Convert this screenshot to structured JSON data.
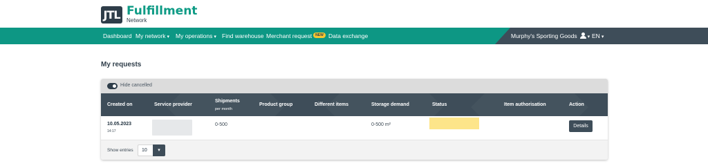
{
  "brand": {
    "logo_mark": "JTL",
    "name": "Fulfillment",
    "sub": "Network"
  },
  "nav": {
    "items": [
      {
        "label": "Dashboard"
      },
      {
        "label": "My network"
      },
      {
        "label": "My operations"
      },
      {
        "label": "Find warehouse"
      },
      {
        "label": "Merchant request",
        "badge": "NEW"
      },
      {
        "label": "Data exchange"
      }
    ],
    "account_name": "Murphy's Sporting Goods",
    "language": "EN",
    "chevron": "▾",
    "user_icon": "user-icon"
  },
  "page": {
    "title": "My requests"
  },
  "filter": {
    "toggle_label": "Hide cancelled",
    "toggle_on": true
  },
  "table": {
    "headers": {
      "created_on": "Created on",
      "service_provider": "Service provider",
      "shipments": "Shipments",
      "shipments_sub": "per month",
      "product_group": "Product group",
      "different_items": "Different items",
      "storage_demand": "Storage demand",
      "status": "Status",
      "item_authorisation": "Item authorisation",
      "action": "Action"
    },
    "rows": [
      {
        "date": "10.05.2023",
        "time": "14:17",
        "shipments": "0-500",
        "storage_demand": "0-500 m²",
        "action": "Details"
      }
    ]
  },
  "footer": {
    "show_entries_label": "Show entries",
    "entries_value": "10",
    "dropdown_icon": "chevron-down-icon"
  },
  "colors": {
    "brand_green": "#0d9784",
    "dark_slate": "#3e4d59",
    "status_yellow": "#fde58a",
    "badge_yellow": "#f7c631"
  }
}
